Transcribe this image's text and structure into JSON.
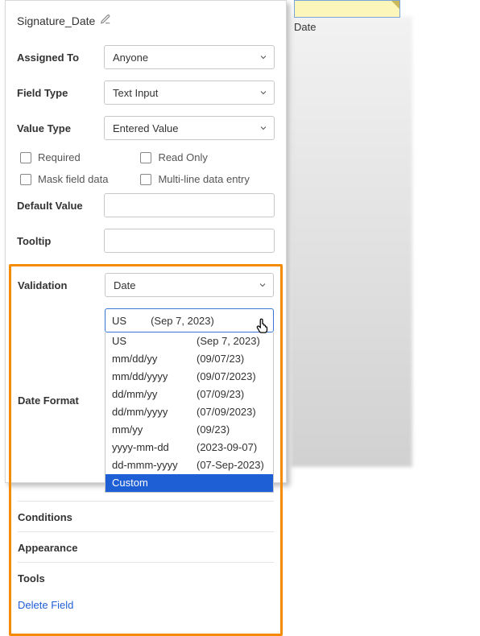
{
  "fieldName": "Signature_Date",
  "labels": {
    "assignedTo": "Assigned To",
    "fieldType": "Field Type",
    "valueType": "Value Type",
    "required": "Required",
    "readOnly": "Read Only",
    "maskFieldData": "Mask field data",
    "multiLine": "Multi-line data entry",
    "defaultValue": "Default Value",
    "tooltip": "Tooltip",
    "validation": "Validation",
    "dateFormat": "Date Format",
    "conditions": "Conditions",
    "appearance": "Appearance",
    "tools": "Tools",
    "deleteField": "Delete Field"
  },
  "values": {
    "assignedTo": "Anyone",
    "fieldType": "Text Input",
    "valueType": "Entered Value",
    "validation": "Date",
    "dateFormatSelectedFmt": "US",
    "dateFormatSelectedEx": "(Sep 7, 2023)"
  },
  "dateFormatOptions": [
    {
      "fmt": "US",
      "ex": "(Sep 7, 2023)"
    },
    {
      "fmt": "mm/dd/yy",
      "ex": "(09/07/23)"
    },
    {
      "fmt": "mm/dd/yyyy",
      "ex": "(09/07/2023)"
    },
    {
      "fmt": "dd/mm/yy",
      "ex": "(07/09/23)"
    },
    {
      "fmt": "dd/mm/yyyy",
      "ex": "(07/09/2023)"
    },
    {
      "fmt": "mm/yy",
      "ex": "(09/23)"
    },
    {
      "fmt": "yyyy-mm-dd",
      "ex": "(2023-09-07)"
    },
    {
      "fmt": "dd-mmm-yyyy",
      "ex": "(07-Sep-2023)"
    },
    {
      "fmt": "Custom",
      "ex": ""
    }
  ],
  "highlightedOption": "Custom",
  "preview": {
    "label": "Date"
  }
}
